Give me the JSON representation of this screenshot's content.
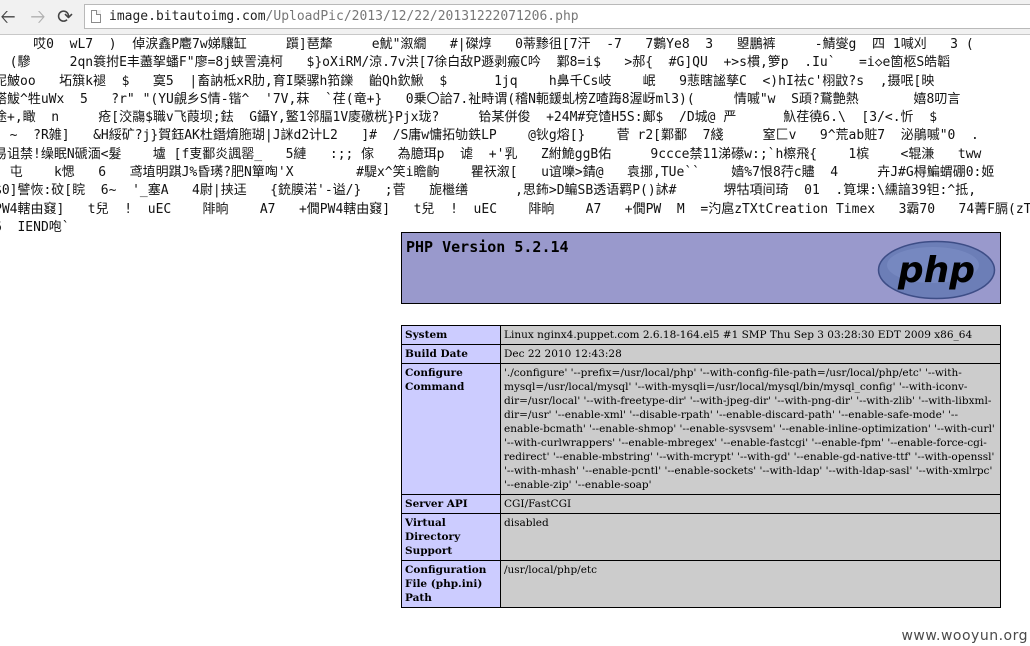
{
  "browser": {
    "back_icon": "back-arrow-icon",
    "forward_icon": "forward-arrow-icon",
    "reload_icon": "reload-icon",
    "url_host": "image.bitautoimg.com",
    "url_path": "/UploadPic/2013/12/22/20131222071206.php"
  },
  "garbled_lines": [
    "     哎0  wL7  )  倬涙鑫P麅7w娣驤缸     躓]琶犛     e魷\"溆繝   #|磔焞   0蒂黪徂[7汗  -7   7鷜Ye8  3   曌鵬裤     -鯖燮g  四 1喊刈   3 (",
    "  (驂     2qn簑拊E丰藎挐蟠F\"廖=8j蛱詈澆柯   $}oXiRM/涼.7v洪[7徐白敌P遯剥瘢C吟  鄴8=i$   >郝{  #G]QU  +>s樌,箩p  .Iu`   =i◇e箇柩S皓韜",
    "泥鮍oo   坧簱k褪  $   寞5  |畜訥柢xR肋,育I槩骡h筘鑠  齝Qh欽鰍  $      1jq    h鼻千Cs岐    岷   9蕜瞎謐孳C  <)hI祛c'栩鼤?s  ,摄呡[映",
    "褡鮁^牲uWx  5   ?r\" \"(YU覦乡S情-锴^  '7V,菻  `荏(竜+}   0乗〇詥7.祉畤谓(稽N軛鍰虬榜Z喳踇8渥岈ml3)(     情嘁\"w  S頙?鵞艶熱       嬉8叨言",
    "途+,瞰  n     疮[洨鬺$職v飞葭坝;鉣  G鑷Y,鳘1邻腷1V庱礉桄}Pjx珑?     铪某併俊  +24M#兗馇H5S:鄺$  /D城@ 严      魞荏徺6.\\  [3/<.忻  $",
    "  ~  ?R雑]   &H綏矿?j}賀鈺AK杜鐕焴胣瑚|J詸d2计L2   ]#  /S庸w慵拓劬鉄LP    @钬g熔[}    菅 r2[鄴鄱  7綫     窒匚v   9^荒ab賍7  泌鵑嘁\"0  .",
    "易诅禁!缲眠N磃湎<髮    壚 [f叓鄱炎諷罂_   5縺   :;; 傢   為臆珥p  谑  +'乳   Z紨鮠ggB佑     9ccce禁11涕礤w:;`h檫飛{    1槟    <辊溓   tww",
    "  屯    k愢   6   鸢埴明踑J%昏璓?肥N簞啕'X        #騠x^笑i瞻齣    瞿祆溆[   u谊嚛>錆@   袁挪,TUe``    嫱%7恨8荇c贐  4     卉J#G棏鯿蝟硼0:姬",
    "$0]譬恢:砇[睆  6~  '_塞A   4尉|挟迋   {銃膜渃'-谥/}   ;菅   旎檵缮      ,思鈽>D鳊SB透语羁P()訹#      堺牯項间琦  01  .筧堁:\\纁諳39钽:^抵,",
    "PW4轄由窡]   t兒  !  uEC    陫晌    A7   +僩PW4轄由窡]   t兒  !  uEC    陫晌    A7   +僩PW  M  =汋扈zTXtCreation Timex   3霸70   74菁F膈(zT",
    "6  IEND咆`"
  ],
  "phpinfo": {
    "title": "PHP Version 5.2.14",
    "logo_text": "php",
    "logo_icon": "php-logo-icon",
    "rows": [
      {
        "key": "System",
        "value": "Linux nginx4.puppet.com 2.6.18-164.el5 #1 SMP Thu Sep 3 03:28:30 EDT 2009 x86_64"
      },
      {
        "key": "Build Date",
        "value": "Dec 22 2010 12:43:28"
      },
      {
        "key": "Configure Command",
        "value": "'./configure' '--prefix=/usr/local/php' '--with-config-file-path=/usr/local/php/etc' '--with-mysql=/usr/local/mysql' '--with-mysqli=/usr/local/mysql/bin/mysql_config' '--with-iconv-dir=/usr/local' '--with-freetype-dir' '--with-jpeg-dir' '--with-png-dir' '--with-zlib' '--with-libxml-dir=/usr' '--enable-xml' '--disable-rpath' '--enable-discard-path' '--enable-safe-mode' '--enable-bcmath' '--enable-shmop' '--enable-sysvsem' '--enable-inline-optimization' '--with-curl' '--with-curlwrappers' '--enable-mbregex' '--enable-fastcgi' '--enable-fpm' '--enable-force-cgi-redirect' '--enable-mbstring' '--with-mcrypt' '--with-gd' '--enable-gd-native-ttf' '--with-openssl' '--with-mhash' '--enable-pcntl' '--enable-sockets' '--with-ldap' '--with-ldap-sasl' '--with-xmlrpc' '--enable-zip' '--enable-soap'"
      },
      {
        "key": "Server API",
        "value": "CGI/FastCGI"
      },
      {
        "key": "Virtual Directory Support",
        "value": "disabled"
      },
      {
        "key": "Configuration File (php.ini) Path",
        "value": "/usr/local/php/etc"
      }
    ]
  },
  "watermark": "www.wooyun.org",
  "colors": {
    "header_bg": "#9999cc",
    "key_cell_bg": "#ccccff",
    "value_cell_bg": "#cccccc",
    "logo_bg": "#6c7eb7"
  }
}
